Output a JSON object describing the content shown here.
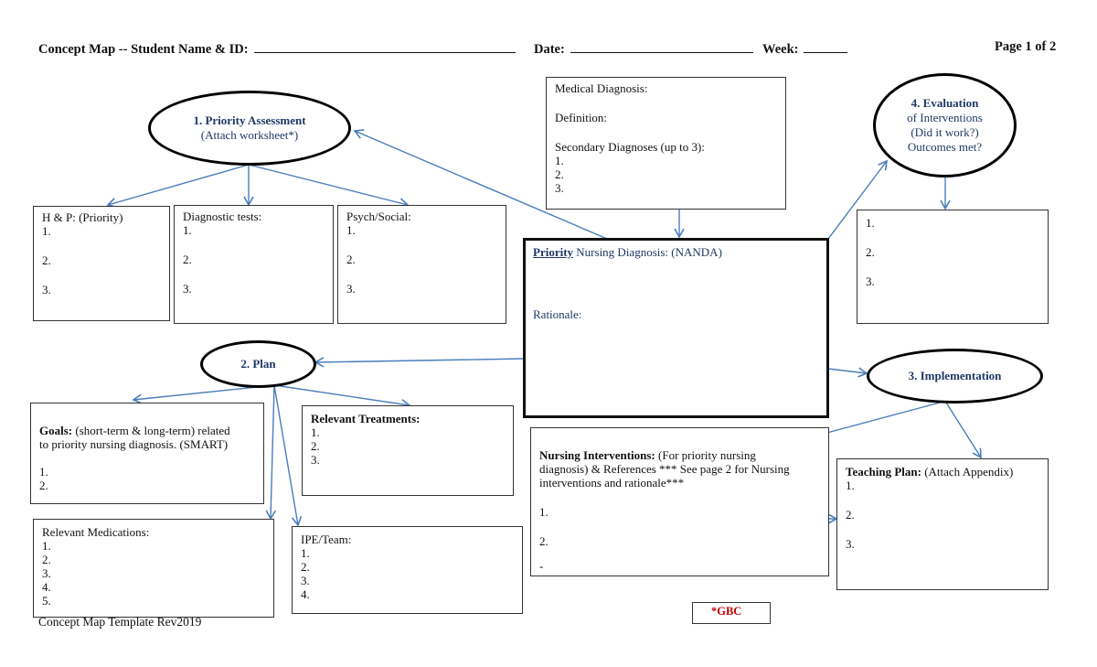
{
  "header": {
    "title_label": "Concept Map -- Student Name & ID:",
    "date_label": "Date:",
    "week_label": "Week:",
    "page_label": "Page 1 of 2"
  },
  "nodes": {
    "assessment": {
      "title": "1. Priority Assessment",
      "subtitle": "(Attach worksheet*)"
    },
    "plan": {
      "title": "2. Plan"
    },
    "implementation": {
      "title": "3. Implementation"
    },
    "evaluation": {
      "title": "4. Evaluation",
      "lines": [
        "of Interventions",
        "(Did it work?)",
        "Outcomes met?"
      ]
    }
  },
  "boxes": {
    "medical_diagnosis": {
      "label": "Medical Diagnosis:",
      "definition_label": "Definition:",
      "secondary_label": "Secondary Diagnoses (up to 3):",
      "items": [
        "1.",
        "2.",
        "3."
      ]
    },
    "hp": {
      "label": "H & P: (Priority)",
      "items": [
        "1.",
        "2.",
        "3."
      ]
    },
    "diagnostic": {
      "label": "Diagnostic tests:",
      "items": [
        "1.",
        "2.",
        "3."
      ]
    },
    "psych": {
      "label": "Psych/Social:",
      "items": [
        "1.",
        "2.",
        "3."
      ]
    },
    "nursing_diagnosis": {
      "label_underlined": "Priority",
      "label_rest": " Nursing Diagnosis: (NANDA)",
      "rationale_label": "Rationale:"
    },
    "evaluation_list": {
      "items": [
        "1.",
        "2.",
        "3."
      ]
    },
    "goals": {
      "label_bold": "Goals:",
      "label_rest": " (short-term & long-term) related",
      "label_line2": "to priority nursing diagnosis.  (SMART)",
      "items": [
        "1.",
        "2."
      ]
    },
    "treatments": {
      "label": "Relevant Treatments:",
      "items": [
        "1.",
        "2.",
        "3."
      ]
    },
    "medications": {
      "label": "Relevant Medications:",
      "items": [
        "1.",
        "2.",
        "3.",
        "4.",
        "5."
      ]
    },
    "ipe": {
      "label": "IPE/Team:",
      "items": [
        "1.",
        "2.",
        "3.",
        "4."
      ]
    },
    "interventions": {
      "label_bold": "Nursing Interventions:",
      "label_rest": " (For priority nursing",
      "label_line2": "diagnosis) & References *** See page 2 for Nursing",
      "label_line3": "interventions and rationale***",
      "items": [
        "1.",
        "2.",
        "-"
      ]
    },
    "teaching": {
      "label_bold": "Teaching Plan:",
      "label_rest": " (Attach Appendix)",
      "items": [
        "1.",
        "2.",
        "3."
      ]
    }
  },
  "footer": {
    "template_label": "Concept Map Template Rev2019",
    "gbc_label": "*GBC"
  },
  "colors": {
    "arrow": "#4a7ebb",
    "node_text": "#1f3864",
    "gbc": "#c00000"
  }
}
